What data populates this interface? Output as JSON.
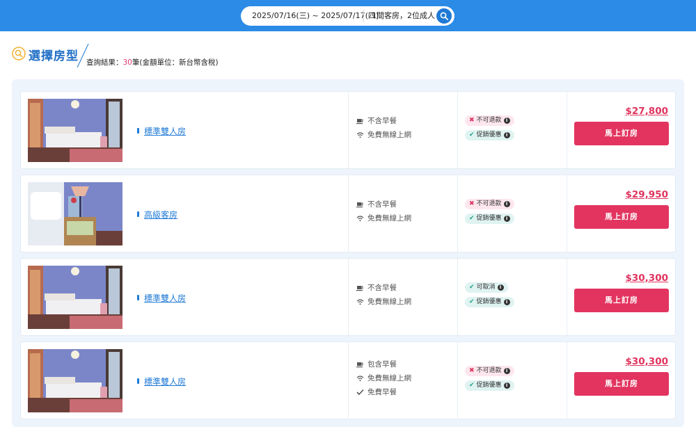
{
  "header": {
    "dates": "2025/07/16(三) ~ 2025/07/17(四)",
    "guests": "1間客房，2位成人",
    "search_icon": "search-icon"
  },
  "section": {
    "title": "選擇房型",
    "result_prefix": "查詢結果：",
    "result_count": "30",
    "result_suffix": "筆(金額單位：新台幣含稅)"
  },
  "colors": {
    "header_bg": "#2b8be6",
    "accent_blue": "#1f7ad6",
    "price_pink": "#e0345f",
    "button_pink": "#e2345f"
  },
  "rooms": [
    {
      "name": "標準雙人房",
      "photo": "room-photo-standard",
      "amenities": [
        {
          "icon": "coffee-cup-icon",
          "text": "不含早餐"
        },
        {
          "icon": "wifi-icon",
          "text": "免費無線上網"
        }
      ],
      "badges": [
        {
          "type": "red",
          "mark": "✖",
          "text": "不可退款",
          "icon": "info-icon"
        },
        {
          "type": "green",
          "mark": "✔",
          "text": "促銷優惠",
          "icon": "info-icon"
        }
      ],
      "price": "$27,800",
      "button": "馬上訂房"
    },
    {
      "name": "高級客房",
      "photo": "room-photo-superior",
      "amenities": [
        {
          "icon": "coffee-cup-icon",
          "text": "不含早餐"
        },
        {
          "icon": "wifi-icon",
          "text": "免費無線上網"
        }
      ],
      "badges": [
        {
          "type": "red",
          "mark": "✖",
          "text": "不可退款",
          "icon": "info-icon"
        },
        {
          "type": "green",
          "mark": "✔",
          "text": "促銷優惠",
          "icon": "info-icon"
        }
      ],
      "price": "$29,950",
      "button": "馬上訂房"
    },
    {
      "name": "標準雙人房",
      "photo": "room-photo-standard",
      "amenities": [
        {
          "icon": "coffee-cup-icon",
          "text": "不含早餐"
        },
        {
          "icon": "wifi-icon",
          "text": "免費無線上網"
        }
      ],
      "badges": [
        {
          "type": "green",
          "mark": "✔",
          "text": "可取消",
          "icon": "info-icon"
        },
        {
          "type": "green",
          "mark": "✔",
          "text": "促銷優惠",
          "icon": "info-icon"
        }
      ],
      "price": "$30,300",
      "button": "馬上訂房"
    },
    {
      "name": "標準雙人房",
      "photo": "room-photo-standard",
      "amenities": [
        {
          "icon": "coffee-cup-icon",
          "text": "包含早餐"
        },
        {
          "icon": "wifi-icon",
          "text": "免費無線上網"
        },
        {
          "icon": "check-icon",
          "text": "免費早餐"
        }
      ],
      "badges": [
        {
          "type": "red",
          "mark": "✖",
          "text": "不可退款",
          "icon": "info-icon"
        },
        {
          "type": "green",
          "mark": "✔",
          "text": "促銷優惠",
          "icon": "info-icon"
        }
      ],
      "price": "$30,300",
      "button": "馬上訂房"
    }
  ]
}
